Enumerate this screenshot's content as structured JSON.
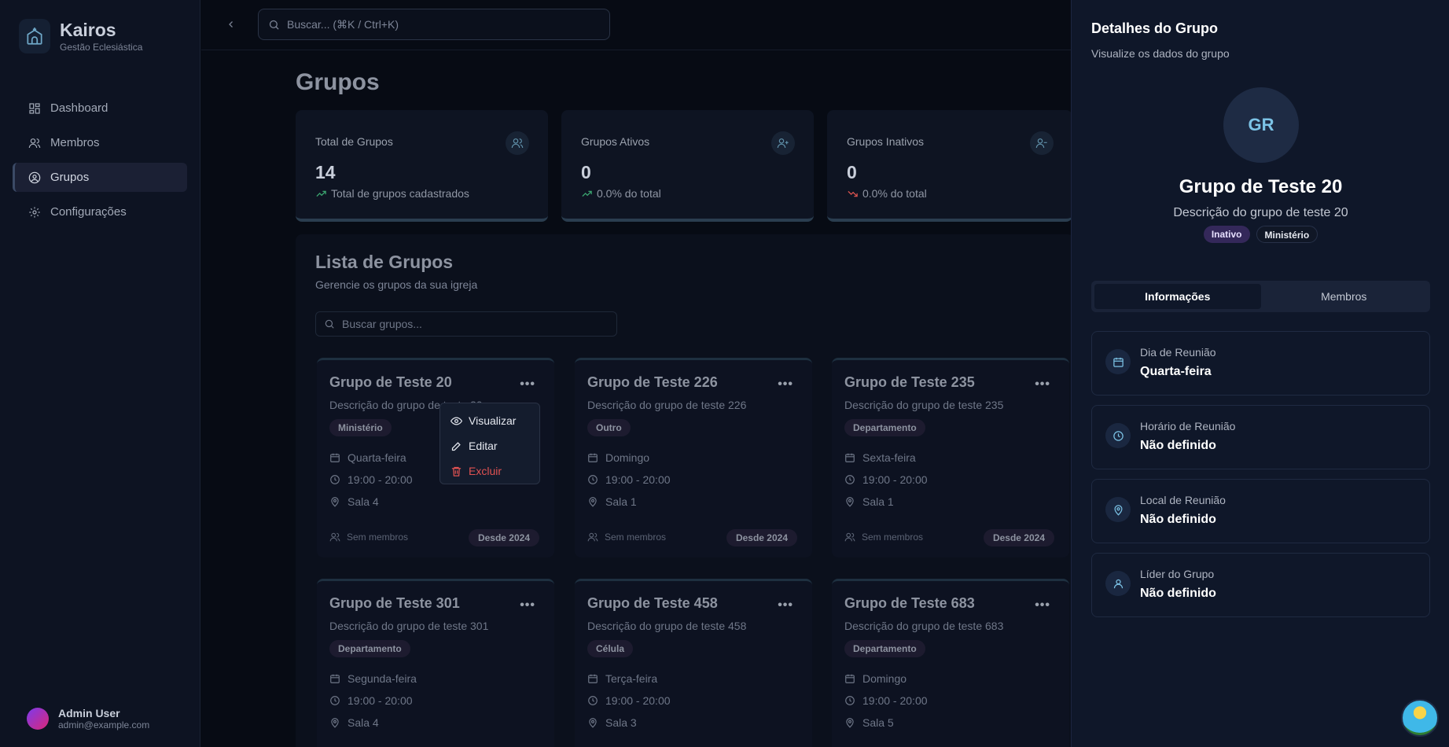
{
  "brand": {
    "name": "Kairos",
    "subtitle": "Gestão Eclesiástica"
  },
  "sidebar": {
    "items": [
      {
        "label": "Dashboard",
        "icon": "grid-icon"
      },
      {
        "label": "Membros",
        "icon": "users-icon"
      },
      {
        "label": "Grupos",
        "icon": "user-circle-icon",
        "active": true
      },
      {
        "label": "Configurações",
        "icon": "gear-icon"
      }
    ]
  },
  "user": {
    "name": "Admin User",
    "email": "admin@example.com"
  },
  "topbar": {
    "search_placeholder": "Buscar... (⌘K / Ctrl+K)"
  },
  "page": {
    "title": "Grupos"
  },
  "stats": [
    {
      "label": "Total de Grupos",
      "value": "14",
      "trend": "Total de grupos cadastrados",
      "trend_dir": "up"
    },
    {
      "label": "Grupos Ativos",
      "value": "0",
      "trend": "0.0% do total",
      "trend_dir": "up"
    },
    {
      "label": "Grupos Inativos",
      "value": "0",
      "trend": "0.0% do total",
      "trend_dir": "down"
    }
  ],
  "list": {
    "title": "Lista de Grupos",
    "subtitle": "Gerencie os grupos da sua igreja",
    "search_placeholder": "Buscar grupos..."
  },
  "groups": [
    {
      "name": "Grupo de Teste 20",
      "description": "Descrição do grupo de teste 20",
      "type": "Ministério",
      "day": "Quarta-feira",
      "time": "19:00 - 20:00",
      "place": "Sala 4",
      "members": "Sem membros",
      "since": "Desde 2024"
    },
    {
      "name": "Grupo de Teste 226",
      "description": "Descrição do grupo de teste 226",
      "type": "Outro",
      "day": "Domingo",
      "time": "19:00 - 20:00",
      "place": "Sala 1",
      "members": "Sem membros",
      "since": "Desde 2024"
    },
    {
      "name": "Grupo de Teste 235",
      "description": "Descrição do grupo de teste 235",
      "type": "Departamento",
      "day": "Sexta-feira",
      "time": "19:00 - 20:00",
      "place": "Sala 1",
      "members": "Sem membros",
      "since": "Desde 2024"
    },
    {
      "name": "Grupo de Teste 301",
      "description": "Descrição do grupo de teste 301",
      "type": "Departamento",
      "day": "Segunda-feira",
      "time": "19:00 - 20:00",
      "place": "Sala 4"
    },
    {
      "name": "Grupo de Teste 458",
      "description": "Descrição do grupo de teste 458",
      "type": "Célula",
      "day": "Terça-feira",
      "time": "19:00 - 20:00",
      "place": "Sala 3"
    },
    {
      "name": "Grupo de Teste 683",
      "description": "Descrição do grupo de teste 683",
      "type": "Departamento",
      "day": "Domingo",
      "time": "19:00 - 20:00",
      "place": "Sala 5"
    }
  ],
  "context_menu": {
    "view": "Visualizar",
    "edit": "Editar",
    "delete": "Excluir"
  },
  "drawer": {
    "title": "Detalhes do Grupo",
    "subtitle": "Visualize os dados do grupo",
    "avatar_initials": "GR",
    "name": "Grupo de Teste 20",
    "description": "Descrição do grupo de teste 20",
    "status_badge": "Inativo",
    "type_badge": "Ministério",
    "tabs": [
      {
        "label": "Informações",
        "active": true
      },
      {
        "label": "Membros"
      }
    ],
    "info": [
      {
        "label": "Dia de Reunião",
        "value": "Quarta-feira",
        "icon": "calendar-icon"
      },
      {
        "label": "Horário de Reunião",
        "value": "Não definido",
        "icon": "clock-icon"
      },
      {
        "label": "Local de Reunião",
        "value": "Não definido",
        "icon": "map-pin-icon"
      },
      {
        "label": "Líder do Grupo",
        "value": "Não definido",
        "icon": "user-icon"
      }
    ]
  },
  "colors": {
    "accent": "#7cc3e6",
    "danger": "#e05252",
    "status_badge": "#34285a",
    "trend_up": "#3aa36f",
    "trend_down": "#d9534f"
  }
}
